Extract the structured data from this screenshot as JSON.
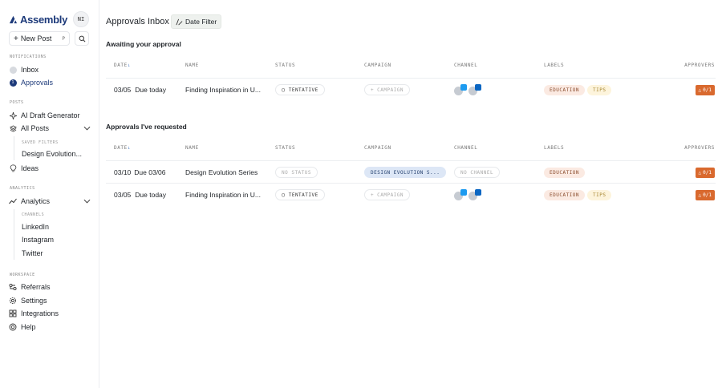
{
  "app": {
    "brand": "Assembly",
    "user_initials": "NI"
  },
  "sidebar": {
    "new_post_label": "New Post",
    "new_post_shortcut": "P",
    "sections": {
      "notifications": "NOTIFICATIONS",
      "posts": "POSTS",
      "analytics": "ANALYTICS",
      "workspace": "WORKSPACE"
    },
    "inbox_label": "Inbox",
    "approvals_label": "Approvals",
    "approvals_count": "1",
    "ai_draft_label": "AI Draft Generator",
    "all_posts_label": "All Posts",
    "saved_filters_label": "SAVED FILTERS",
    "saved_filter_item": "Design Evolution...",
    "ideas_label": "Ideas",
    "analytics_label": "Analytics",
    "channels_label": "CHANNELS",
    "channels": [
      "LinkedIn",
      "Instagram",
      "Twitter"
    ],
    "referrals_label": "Referrals",
    "settings_label": "Settings",
    "integrations_label": "Integrations",
    "help_label": "Help"
  },
  "main": {
    "title": "Approvals Inbox",
    "date_filter_label": "Date Filter",
    "columns": {
      "date": "DATE",
      "name": "NAME",
      "status": "STATUS",
      "campaign": "CAMPAIGN",
      "channel": "CHANNEL",
      "labels": "LABELS",
      "approvers": "APPROVERS"
    },
    "awaiting": {
      "title": "Awaiting your approval",
      "rows": [
        {
          "date": "03/05",
          "due": "Due today",
          "name": "Finding Inspiration in U...",
          "status": "TENTATIVE",
          "campaign": "CAMPAIGN",
          "label1": "EDUCATION",
          "label2": "TIPS",
          "approvers": "0/1"
        }
      ]
    },
    "requested": {
      "title": "Approvals I've requested",
      "rows": [
        {
          "date": "03/10",
          "due": "Due 03/06",
          "name": "Design Evolution Series",
          "status": "NO STATUS",
          "campaign": "DESIGN EVOLUTION S...",
          "channel": "NO CHANNEL",
          "label1": "EDUCATION",
          "approvers": "0/1"
        },
        {
          "date": "03/05",
          "due": "Due today",
          "name": "Finding Inspiration in U...",
          "status": "TENTATIVE",
          "campaign": "CAMPAIGN",
          "label1": "EDUCATION",
          "label2": "TIPS",
          "approvers": "0/1"
        }
      ]
    }
  },
  "colors": {
    "brand": "#1d3a7a",
    "approver_badge": "#d9692e",
    "twitter": "#1d9bf0",
    "linkedin": "#0a66c2"
  }
}
